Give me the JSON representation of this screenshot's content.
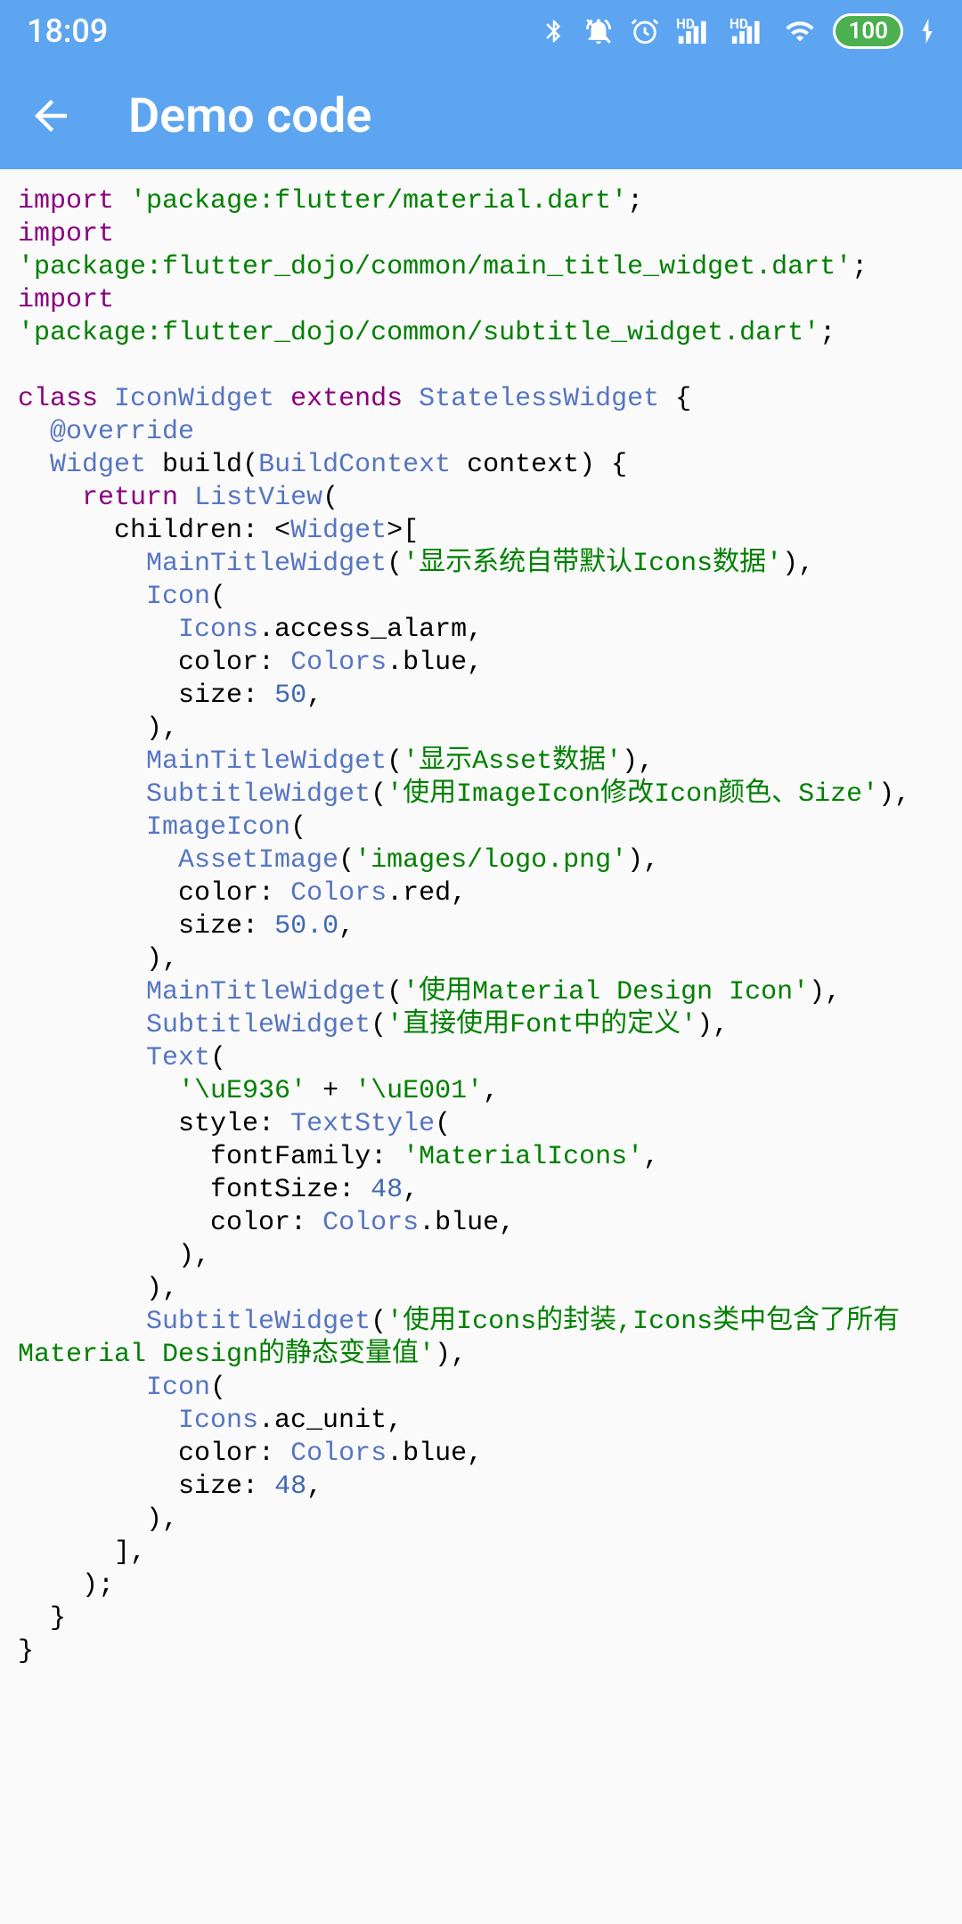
{
  "status": {
    "time": "18:09",
    "battery": "100"
  },
  "appbar": {
    "title": "Demo code"
  },
  "code": {
    "tokens": [
      {
        "t": "kw",
        "s": "import"
      },
      {
        "t": "",
        "s": " "
      },
      {
        "t": "str",
        "s": "'package:flutter/material.dart'"
      },
      {
        "t": "",
        "s": ";\n"
      },
      {
        "t": "kw",
        "s": "import"
      },
      {
        "t": "",
        "s": " "
      },
      {
        "t": "str",
        "s": "'package:flutter_dojo/common/main_title_widget.dart'"
      },
      {
        "t": "",
        "s": ";\n"
      },
      {
        "t": "kw",
        "s": "import"
      },
      {
        "t": "",
        "s": " "
      },
      {
        "t": "str",
        "s": "'package:flutter_dojo/common/subtitle_widget.dart'"
      },
      {
        "t": "",
        "s": ";\n"
      },
      {
        "t": "",
        "s": "\n"
      },
      {
        "t": "kw",
        "s": "class"
      },
      {
        "t": "",
        "s": " "
      },
      {
        "t": "cls",
        "s": "IconWidget"
      },
      {
        "t": "",
        "s": " "
      },
      {
        "t": "kw",
        "s": "extends"
      },
      {
        "t": "",
        "s": " "
      },
      {
        "t": "cls",
        "s": "StatelessWidget"
      },
      {
        "t": "",
        "s": " {\n"
      },
      {
        "t": "",
        "s": "  "
      },
      {
        "t": "ann",
        "s": "@override"
      },
      {
        "t": "",
        "s": "\n"
      },
      {
        "t": "",
        "s": "  "
      },
      {
        "t": "cls",
        "s": "Widget"
      },
      {
        "t": "",
        "s": " build("
      },
      {
        "t": "cls",
        "s": "BuildContext"
      },
      {
        "t": "",
        "s": " context) {\n"
      },
      {
        "t": "",
        "s": "    "
      },
      {
        "t": "kw",
        "s": "return"
      },
      {
        "t": "",
        "s": " "
      },
      {
        "t": "cls",
        "s": "ListView"
      },
      {
        "t": "",
        "s": "(\n"
      },
      {
        "t": "",
        "s": "      children: <"
      },
      {
        "t": "cls",
        "s": "Widget"
      },
      {
        "t": "",
        "s": ">[\n"
      },
      {
        "t": "",
        "s": "        "
      },
      {
        "t": "cls",
        "s": "MainTitleWidget"
      },
      {
        "t": "",
        "s": "("
      },
      {
        "t": "str",
        "s": "'显示系统自带默认Icons数据'"
      },
      {
        "t": "",
        "s": "),\n"
      },
      {
        "t": "",
        "s": "        "
      },
      {
        "t": "cls",
        "s": "Icon"
      },
      {
        "t": "",
        "s": "(\n"
      },
      {
        "t": "",
        "s": "          "
      },
      {
        "t": "cls",
        "s": "Icons"
      },
      {
        "t": "",
        "s": ".access_alarm,\n"
      },
      {
        "t": "",
        "s": "          color: "
      },
      {
        "t": "cls",
        "s": "Colors"
      },
      {
        "t": "",
        "s": ".blue,\n"
      },
      {
        "t": "",
        "s": "          size: "
      },
      {
        "t": "num",
        "s": "50"
      },
      {
        "t": "",
        "s": ",\n"
      },
      {
        "t": "",
        "s": "        ),\n"
      },
      {
        "t": "",
        "s": "        "
      },
      {
        "t": "cls",
        "s": "MainTitleWidget"
      },
      {
        "t": "",
        "s": "("
      },
      {
        "t": "str",
        "s": "'显示Asset数据'"
      },
      {
        "t": "",
        "s": "),\n"
      },
      {
        "t": "",
        "s": "        "
      },
      {
        "t": "cls",
        "s": "SubtitleWidget"
      },
      {
        "t": "",
        "s": "("
      },
      {
        "t": "str",
        "s": "'使用ImageIcon修改Icon颜色、Size'"
      },
      {
        "t": "",
        "s": "),\n"
      },
      {
        "t": "",
        "s": "        "
      },
      {
        "t": "cls",
        "s": "ImageIcon"
      },
      {
        "t": "",
        "s": "(\n"
      },
      {
        "t": "",
        "s": "          "
      },
      {
        "t": "cls",
        "s": "AssetImage"
      },
      {
        "t": "",
        "s": "("
      },
      {
        "t": "str",
        "s": "'images/logo.png'"
      },
      {
        "t": "",
        "s": "),\n"
      },
      {
        "t": "",
        "s": "          color: "
      },
      {
        "t": "cls",
        "s": "Colors"
      },
      {
        "t": "",
        "s": ".red,\n"
      },
      {
        "t": "",
        "s": "          size: "
      },
      {
        "t": "num",
        "s": "50.0"
      },
      {
        "t": "",
        "s": ",\n"
      },
      {
        "t": "",
        "s": "        ),\n"
      },
      {
        "t": "",
        "s": "        "
      },
      {
        "t": "cls",
        "s": "MainTitleWidget"
      },
      {
        "t": "",
        "s": "("
      },
      {
        "t": "str",
        "s": "'使用Material Design Icon'"
      },
      {
        "t": "",
        "s": "),\n"
      },
      {
        "t": "",
        "s": "        "
      },
      {
        "t": "cls",
        "s": "SubtitleWidget"
      },
      {
        "t": "",
        "s": "("
      },
      {
        "t": "str",
        "s": "'直接使用Font中的定义'"
      },
      {
        "t": "",
        "s": "),\n"
      },
      {
        "t": "",
        "s": "        "
      },
      {
        "t": "cls",
        "s": "Text"
      },
      {
        "t": "",
        "s": "(\n"
      },
      {
        "t": "",
        "s": "          "
      },
      {
        "t": "str",
        "s": "'\\uE936'"
      },
      {
        "t": "",
        "s": " + "
      },
      {
        "t": "str",
        "s": "'\\uE001'"
      },
      {
        "t": "",
        "s": ",\n"
      },
      {
        "t": "",
        "s": "          style: "
      },
      {
        "t": "cls",
        "s": "TextStyle"
      },
      {
        "t": "",
        "s": "(\n"
      },
      {
        "t": "",
        "s": "            fontFamily: "
      },
      {
        "t": "str",
        "s": "'MaterialIcons'"
      },
      {
        "t": "",
        "s": ",\n"
      },
      {
        "t": "",
        "s": "            fontSize: "
      },
      {
        "t": "num",
        "s": "48"
      },
      {
        "t": "",
        "s": ",\n"
      },
      {
        "t": "",
        "s": "            color: "
      },
      {
        "t": "cls",
        "s": "Colors"
      },
      {
        "t": "",
        "s": ".blue,\n"
      },
      {
        "t": "",
        "s": "          ),\n"
      },
      {
        "t": "",
        "s": "        ),\n"
      },
      {
        "t": "",
        "s": "        "
      },
      {
        "t": "cls",
        "s": "SubtitleWidget"
      },
      {
        "t": "",
        "s": "("
      },
      {
        "t": "str",
        "s": "'使用Icons的封装,Icons类中包含了所有Material Design的静态变量值'"
      },
      {
        "t": "",
        "s": "),\n"
      },
      {
        "t": "",
        "s": "        "
      },
      {
        "t": "cls",
        "s": "Icon"
      },
      {
        "t": "",
        "s": "(\n"
      },
      {
        "t": "",
        "s": "          "
      },
      {
        "t": "cls",
        "s": "Icons"
      },
      {
        "t": "",
        "s": ".ac_unit,\n"
      },
      {
        "t": "",
        "s": "          color: "
      },
      {
        "t": "cls",
        "s": "Colors"
      },
      {
        "t": "",
        "s": ".blue,\n"
      },
      {
        "t": "",
        "s": "          size: "
      },
      {
        "t": "num",
        "s": "48"
      },
      {
        "t": "",
        "s": ",\n"
      },
      {
        "t": "",
        "s": "        ),\n"
      },
      {
        "t": "",
        "s": "      ],\n"
      },
      {
        "t": "",
        "s": "    );\n"
      },
      {
        "t": "",
        "s": "  }\n"
      },
      {
        "t": "",
        "s": "}\n"
      }
    ]
  }
}
